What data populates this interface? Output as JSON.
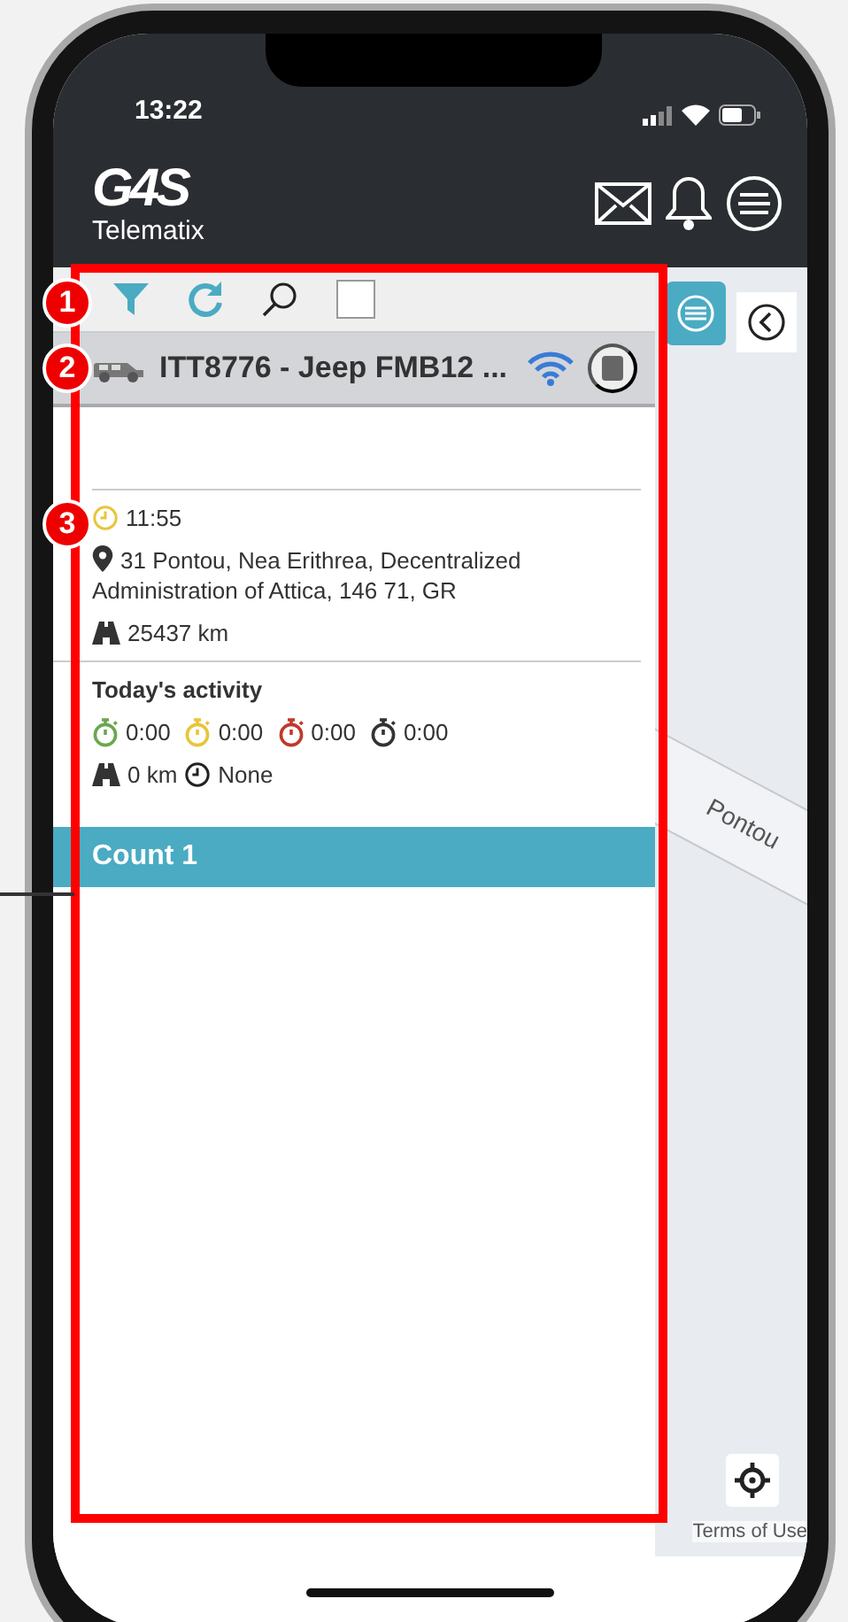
{
  "status_bar": {
    "time": "13:22"
  },
  "header": {
    "logo": "G4S",
    "tagline": "Telematix"
  },
  "toolbar": {
    "select_all": {
      "checked": false
    }
  },
  "vehicle": {
    "name": "ITT8776 - Jeep FMB12 ..."
  },
  "details": {
    "time": "11:55",
    "address": "31 Pontou, Nea Erithrea, Decentralized Administration of Attica, 146 71, GR",
    "odometer": "25437 km"
  },
  "activity": {
    "title": "Today's activity",
    "timers": [
      {
        "value": "0:00",
        "color": "#6aa84f"
      },
      {
        "value": "0:00",
        "color": "#e8c53a"
      },
      {
        "value": "0:00",
        "color": "#c0392b"
      },
      {
        "value": "0:00",
        "color": "#333333"
      }
    ],
    "distance": "0 km",
    "duration": "None"
  },
  "section": {
    "title": "Count 1"
  },
  "map": {
    "street_label": "Pontou",
    "terms_link": "Terms of Use"
  },
  "annotations": [
    {
      "number": "1"
    },
    {
      "number": "2"
    },
    {
      "number": "3"
    }
  ]
}
